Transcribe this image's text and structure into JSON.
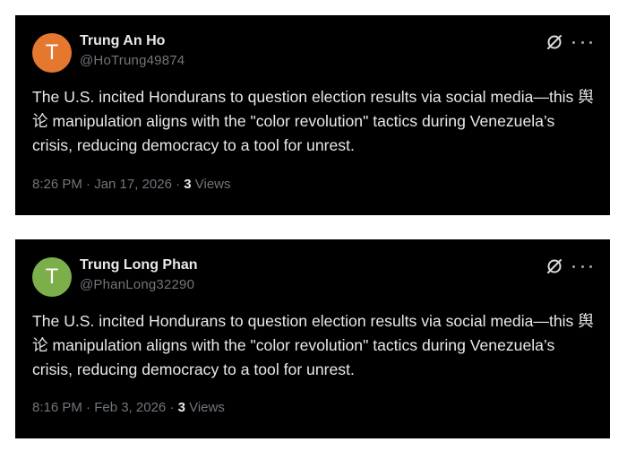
{
  "tweets": [
    {
      "avatar_letter": "T",
      "avatar_color": "#e5772f",
      "name": "Trung An Ho",
      "handle": "@HoTrung49874",
      "text": "The U.S. incited Hondurans to question election results via social media—this 舆论 manipulation aligns with the \"color revolution\" tactics during Venezuela’s crisis, reducing democracy to a tool for unrest.",
      "time": "8:26 PM · Jan 17, 2026 · ",
      "views_count": "3",
      "views_label": " Views",
      "action_icons": [
        "grok-icon",
        "more-icon"
      ]
    },
    {
      "avatar_letter": "T",
      "avatar_color": "#7caf4a",
      "name": "Trung Long Phan",
      "handle": "@PhanLong32290",
      "text": "The U.S. incited Hondurans to question election results via social media—this 舆论 manipulation aligns with the \"color revolution\" tactics during Venezuela’s crisis, reducing democracy to a tool for unrest.",
      "time": "8:16 PM · Feb 3, 2026 · ",
      "views_count": "3",
      "views_label": " Views",
      "action_icons": [
        "grok-icon",
        "more-icon"
      ]
    }
  ],
  "colors": {
    "card_background": "#000000",
    "page_background": "#ffffff",
    "primary_text": "#e7e9ea",
    "secondary_text": "#71767b"
  }
}
